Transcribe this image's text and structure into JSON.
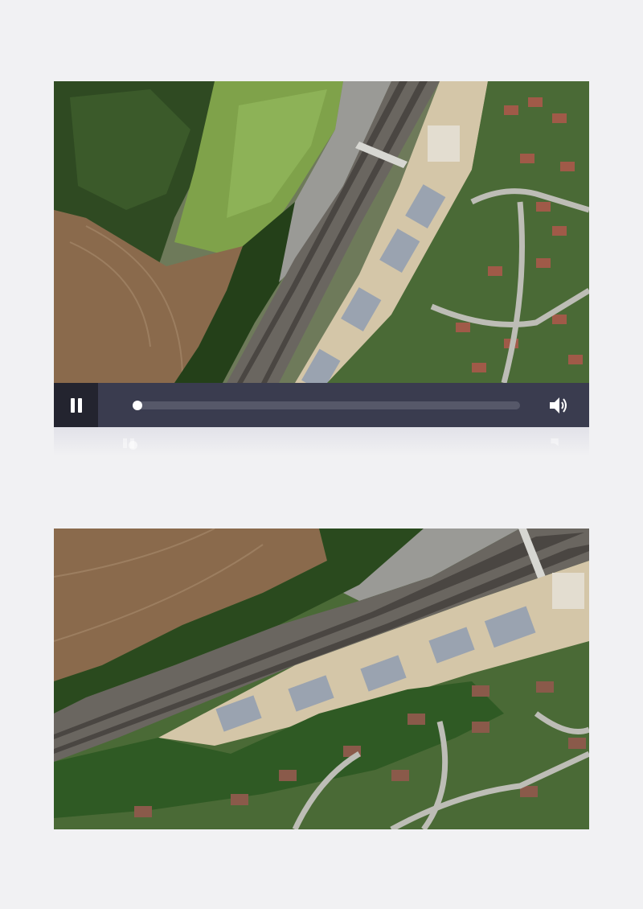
{
  "player": {
    "state": "playing",
    "progress_fraction": 0.0,
    "controls": {
      "play_pause_icon": "pause-icon",
      "volume_icon": "volume-icon"
    }
  },
  "frames": {
    "top": {
      "content": "aerial-photo"
    },
    "bottom": {
      "content": "aerial-photo"
    }
  },
  "colors": {
    "page_background": "#f1f1f3",
    "control_bar": "#3a3c4f",
    "play_button_background": "#23242f",
    "progress_track": "#565869",
    "thumb": "#ffffff"
  }
}
